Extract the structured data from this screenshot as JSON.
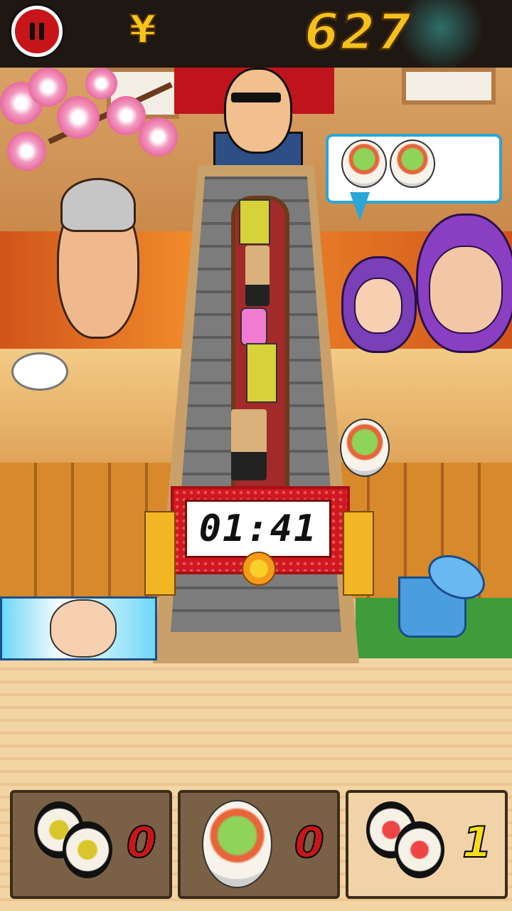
{
  "hud": {
    "currency_symbol": "¥",
    "score": "627",
    "pause_icon": "pause-icon"
  },
  "timer": {
    "value": "01:41"
  },
  "order_bubble": {
    "items": [
      "sushi-roll-icon",
      "sushi-roll-icon"
    ]
  },
  "inventory": [
    {
      "icon": "tamago-maki-icon",
      "count": "0"
    },
    {
      "icon": "salad-roll-icon",
      "count": "0"
    },
    {
      "icon": "tuna-maki-icon",
      "count": "1"
    }
  ],
  "colors": {
    "score_yellow": "#f5c21d",
    "timer_red": "#d01820",
    "bubble_border": "#2aa6d8"
  }
}
